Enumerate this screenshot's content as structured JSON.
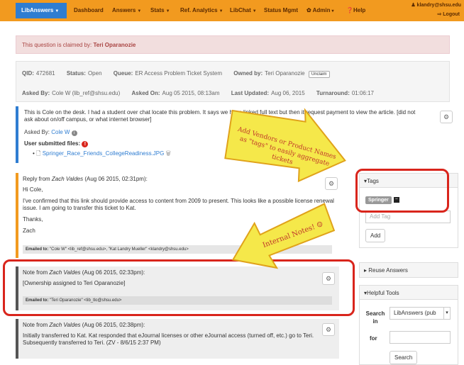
{
  "nav": {
    "brand": "LibAnswers",
    "items": [
      "Dashboard",
      "Answers",
      "Stats",
      "Ref. Analytics",
      "LibChat",
      "Status Mgmt",
      "Admin",
      "Help"
    ],
    "user_email": "klandry@shsu.edu",
    "logout": "Logout"
  },
  "claim": {
    "prefix": "This question is claimed by:",
    "name": "Teri Oparanozie"
  },
  "info": {
    "qid_label": "QID:",
    "qid": "472681",
    "status_label": "Status:",
    "status": "Open",
    "queue_label": "Queue:",
    "queue": "ER Access Problem Ticket System",
    "owner_label": "Owned by:",
    "owner": "Teri Oparanozie",
    "unclaim": "Unclaim",
    "asked_by_label": "Asked By:",
    "asked_by": "Cole W (lib_ref@shsu.edu)",
    "asked_on_label": "Asked On:",
    "asked_on": "Aug 05 2015, 08:13am",
    "updated_label": "Last Updated:",
    "updated": "Aug 06, 2015",
    "turnaround_label": "Turnaround:",
    "turnaround": "01:06:17"
  },
  "question": {
    "text": "This is Cole on the desk. I had a student over chat locate this problem. It says we have linked full text but then it request payment to view the article. [did not ask about on/off campus, or what internet browser]",
    "asked_by_label": "Asked By:",
    "asked_by": "Cole W",
    "files_label": "User submitted files:",
    "file": "Springer_Race_Friends_CollegeReadiness.JPG"
  },
  "reply": {
    "head_prefix": "Reply from",
    "author": "Zach Valdes",
    "date": "(Aug 06 2015, 02:31pm):",
    "greeting": "Hi Cole,",
    "body": "I've confirmed that this link should provide access to content from 2009 to present. This looks like a possible license renewal issue. I am going to transfer this ticket to Kat.",
    "thanks": "Thanks,",
    "sign": "Zach",
    "emailed_label": "Emailed to:",
    "emailed": "\"Cole W\" <lib_ref@shsu.edu>, \"Kat Landry Mueller\" <klandry@shsu.edu>"
  },
  "note1": {
    "head_prefix": "Note from",
    "author": "Zach Valdes",
    "date": "(Aug 06 2015, 02:33pm):",
    "body": "[Ownership assigned to Teri Oparanozie]",
    "emailed_label": "Emailed to:",
    "emailed": "\"Teri Oparanozie\" <lib_tlo@shsu.edu>"
  },
  "note2": {
    "head_prefix": "Note from",
    "author": "Zach Valdes",
    "date": "(Aug 06 2015, 02:38pm):",
    "body": "Initially transferred to Kat. Kat responded that eJournal licenses or other eJournal access (turned off, etc.) go to Teri. Subsequently transferred to Teri. (ZV - 8/6/15 2:37 PM)"
  },
  "sidebar": {
    "tags_title": "Tags",
    "tag": "Springer",
    "add_tag_placeholder": "Add Tag",
    "add_button": "Add",
    "reuse_title": "Reuse Answers",
    "tools_title": "Helpful Tools",
    "search_label": "Search in",
    "search_select": "LibAnswers (pub",
    "for_label": "for",
    "search_button": "Search"
  },
  "callouts": {
    "vendors": "Add Vendors or Product Names as \"tags\" to easily aggregate tickets",
    "internal": "Internal Notes! ☺"
  },
  "colors": {
    "nav": "#f29a1f",
    "brand": "#2f7dd1",
    "highlight": "#d9251c",
    "arrow": "#f5e84a"
  }
}
